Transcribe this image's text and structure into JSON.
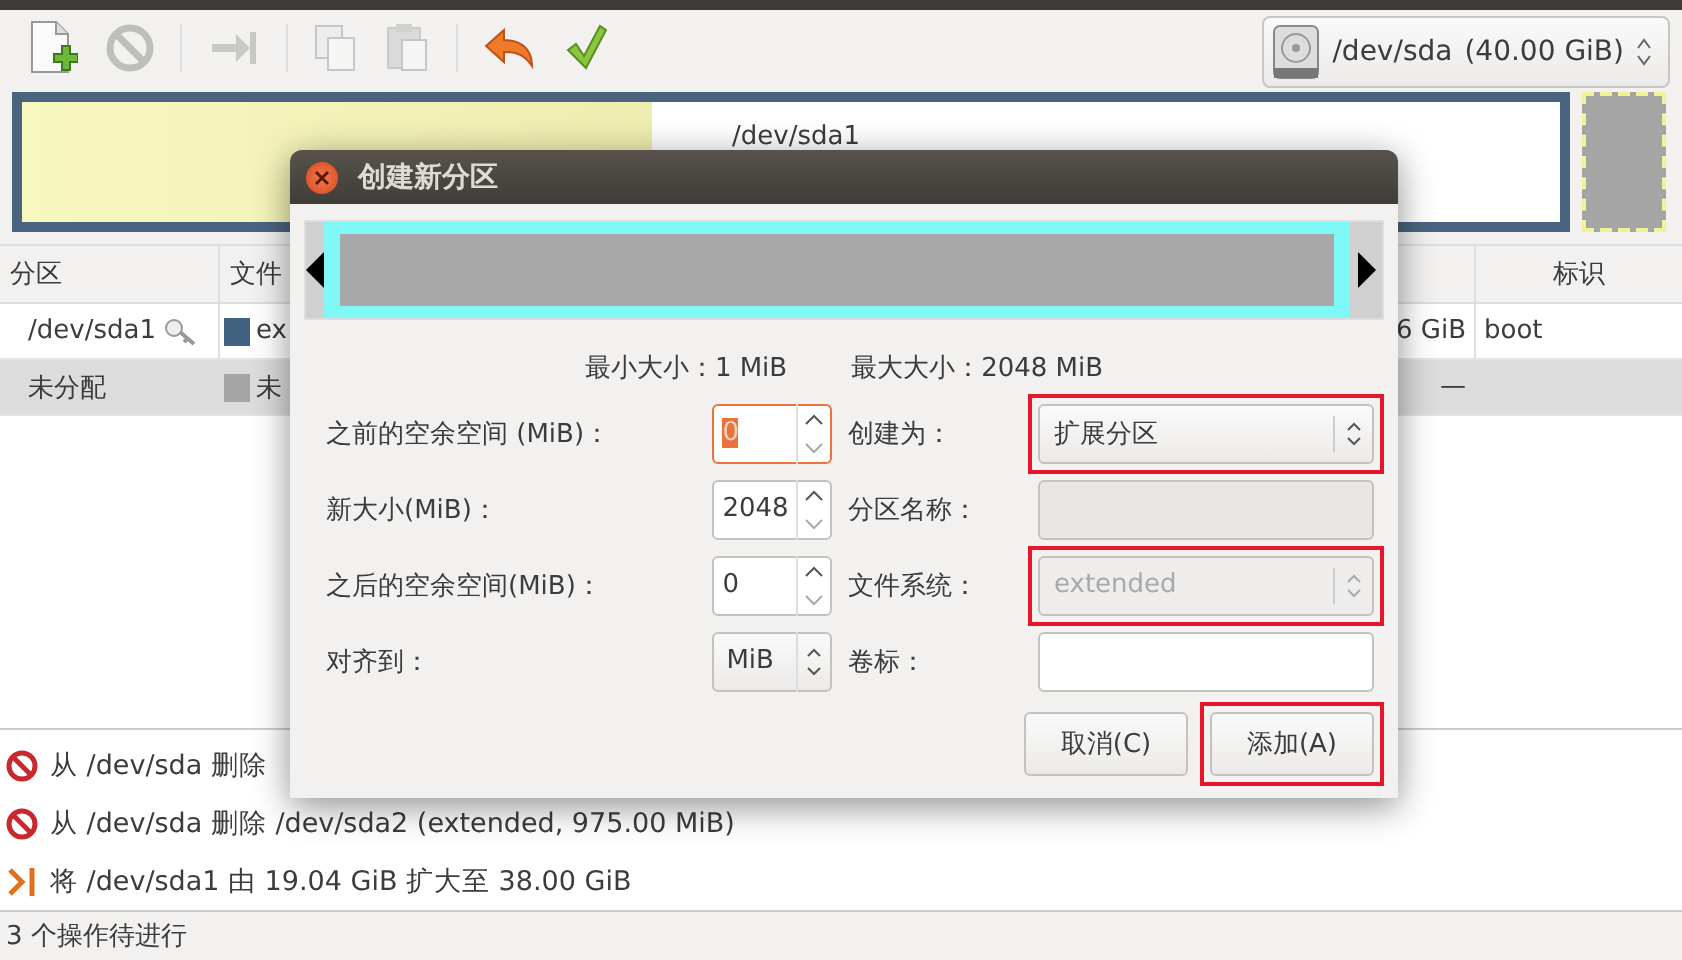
{
  "toolbar": {
    "buttons": [
      {
        "kind": "new",
        "disabled": false
      },
      {
        "kind": "delete",
        "disabled": true
      },
      {
        "kind": "resize",
        "disabled": true
      },
      {
        "kind": "copy",
        "disabled": true
      },
      {
        "kind": "paste",
        "disabled": true
      },
      {
        "kind": "undo",
        "disabled": false
      },
      {
        "kind": "apply",
        "disabled": false
      }
    ]
  },
  "device_selector": {
    "device": "/dev/sda",
    "size": "(40.00 GiB)"
  },
  "partition_map": {
    "label": "/dev/sda1",
    "level": 0.41
  },
  "table": {
    "columns": [
      {
        "label": "分区"
      },
      {
        "label": "文件"
      },
      {
        "label": "标识"
      }
    ],
    "rows": [
      {
        "partition": "/dev/sda1",
        "key": true,
        "color": "#42607f",
        "filesystem": "ex",
        "column_3": "6 GiB",
        "flags": "boot",
        "selected": false
      },
      {
        "partition": "未分配",
        "key": false,
        "color": "#a5a5a5",
        "filesystem": "未",
        "column_3": "—",
        "selected": true
      }
    ]
  },
  "operations": [
    {
      "kind": "delete",
      "text": "从 /dev/sda 删除"
    },
    {
      "kind": "delete",
      "text": "从 /dev/sda 删除 /dev/sda2 (extended, 975.00 MiB)"
    },
    {
      "kind": "grow",
      "text": "将 /dev/sda1 由 19.04 GiB 扩大至 38.00 GiB"
    }
  ],
  "status_bar": "3 个操作待进行",
  "dialog": {
    "title": "创建新分区",
    "min_size": "最小大小：1 MiB",
    "max_size": "最大大小：2048 MiB",
    "fields_left": [
      {
        "label": "之前的空余空间 (MiB)：",
        "kind": "spin",
        "value": "0",
        "focused": true
      },
      {
        "label": "新大小(MiB)：",
        "kind": "spin",
        "value": "2048",
        "focused": false
      },
      {
        "label": "之后的空余空间(MiB)：",
        "kind": "spin",
        "value": "0",
        "focused": false
      },
      {
        "label": "对齐到：",
        "kind": "combo",
        "value": "MiB",
        "focused": false
      }
    ],
    "fields_right": [
      {
        "label": "创建为：",
        "kind": "combo",
        "value": "扩展分区",
        "disabled": false,
        "highlighted": true
      },
      {
        "label": "分区名称：",
        "kind": "text",
        "disabled": true,
        "highlighted": false
      },
      {
        "label": "文件系统：",
        "kind": "combo",
        "value": "extended",
        "disabled": true,
        "highlighted": true
      },
      {
        "label": "卷标：",
        "kind": "text",
        "disabled": false,
        "highlighted": false
      }
    ],
    "buttons": [
      {
        "label": "取消(C)",
        "highlighted": false
      },
      {
        "label": "添加(A)",
        "highlighted": true
      }
    ]
  }
}
